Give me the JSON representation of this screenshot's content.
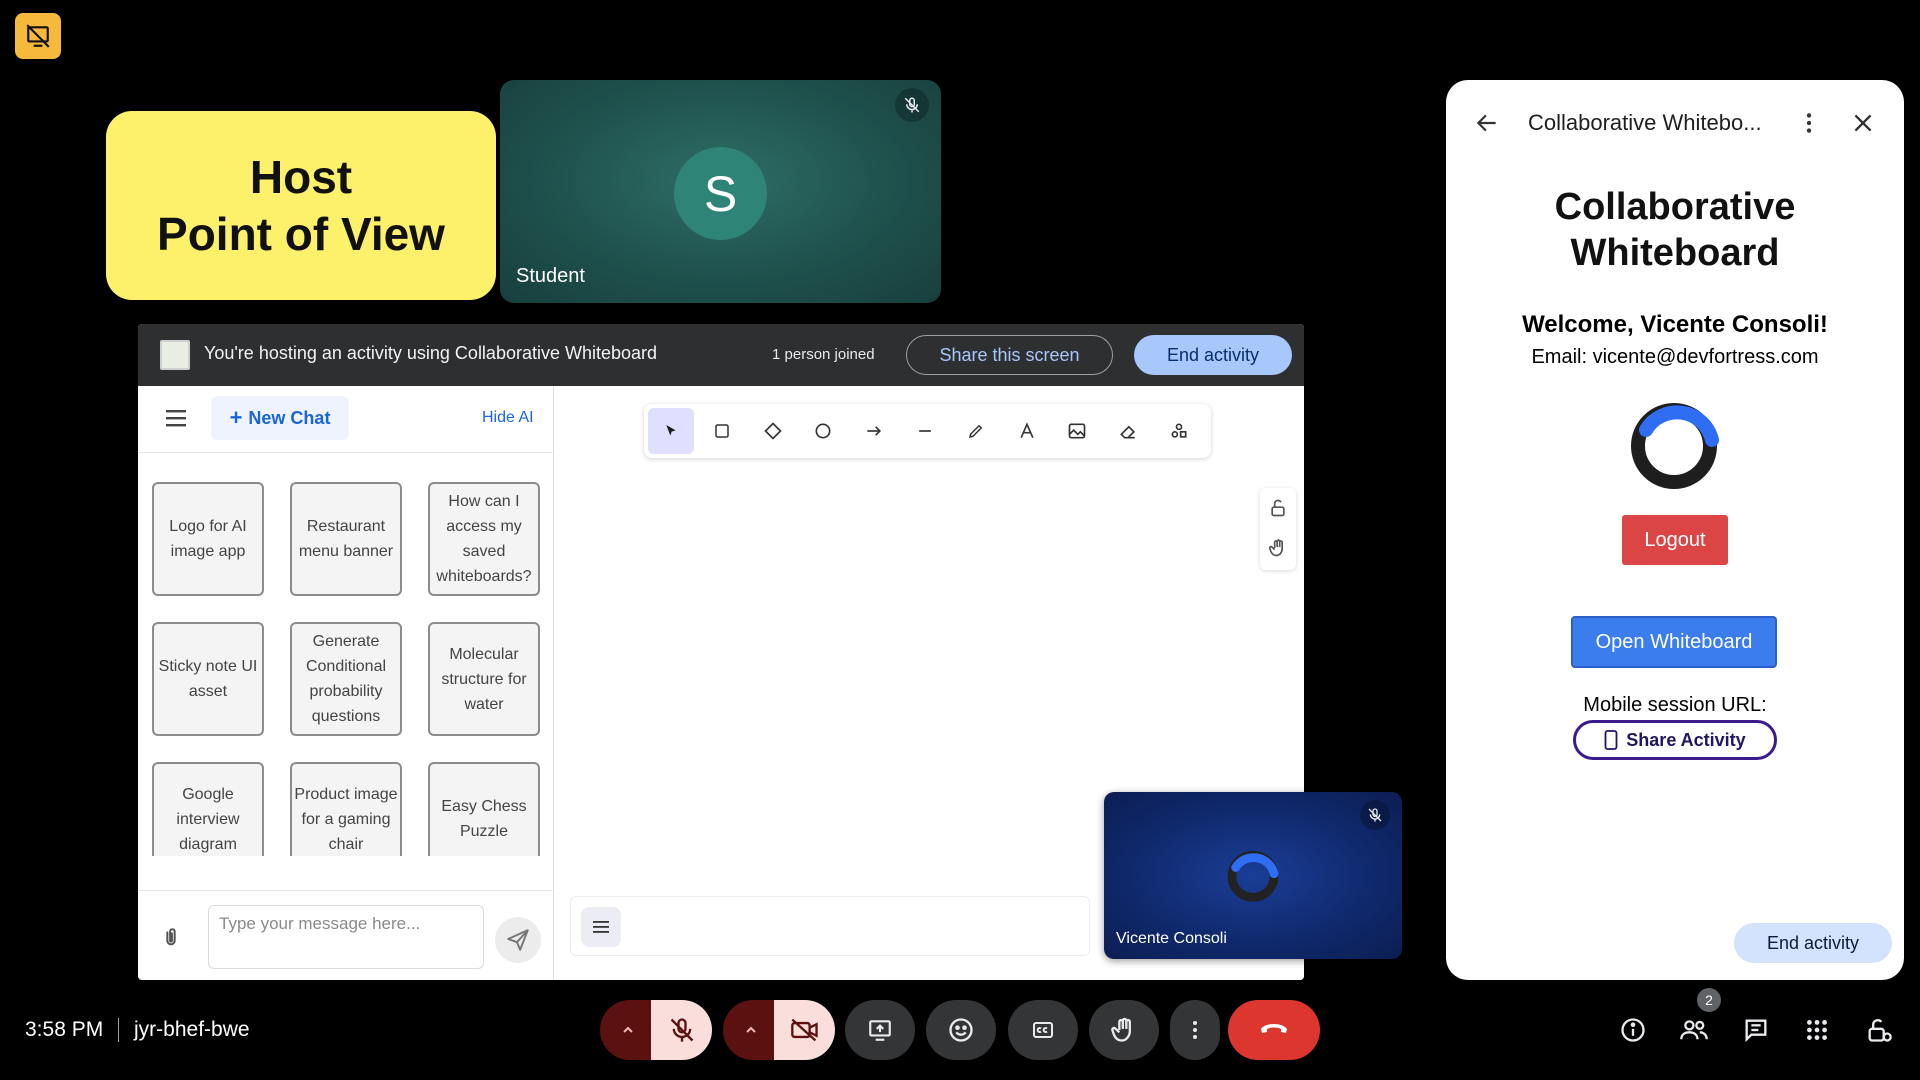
{
  "host_card": {
    "line1": "Host",
    "line2": "Point of View"
  },
  "student_tile": {
    "initial": "S",
    "name": "Student"
  },
  "activity_bar": {
    "message": "You're hosting an activity using Collaborative Whiteboard",
    "joined": "1 person joined",
    "share_label": "Share this screen",
    "end_label": "End activity"
  },
  "ai_panel": {
    "new_chat": "New Chat",
    "hide_ai": "Hide AI",
    "prompts": [
      "Logo for AI image app",
      "Restaurant menu banner",
      "How can I access my saved whiteboards?",
      "Sticky note UI asset",
      "Generate Conditional probability questions",
      "Molecular structure for water",
      "Google interview diagram",
      "Product image for a gaming chair",
      "Easy Chess Puzzle"
    ],
    "input_placeholder": "Type your message here..."
  },
  "vicente_tile": {
    "name": "Vicente Consoli"
  },
  "side_panel": {
    "title": "Collaborative Whitebo...",
    "heading_line1": "Collaborative",
    "heading_line2": "Whiteboard",
    "welcome": "Welcome, Vicente Consoli!",
    "email": "Email: vicente@devfortress.com",
    "logout": "Logout",
    "open_whiteboard": "Open Whiteboard",
    "mobile_url_label": "Mobile session URL:",
    "share_activity": "Share Activity",
    "end_activity": "End activity"
  },
  "bottom_bar": {
    "time": "3:58 PM",
    "meeting_code": "jyr-bhef-bwe",
    "people_count": "2"
  },
  "colors": {
    "host_card_bg": "#fdf06b",
    "end_call_red": "#dc362e",
    "accent_blue": "#a8c7fa",
    "logout_red": "#dc4545",
    "open_whiteboard_blue": "#3b7ded"
  }
}
